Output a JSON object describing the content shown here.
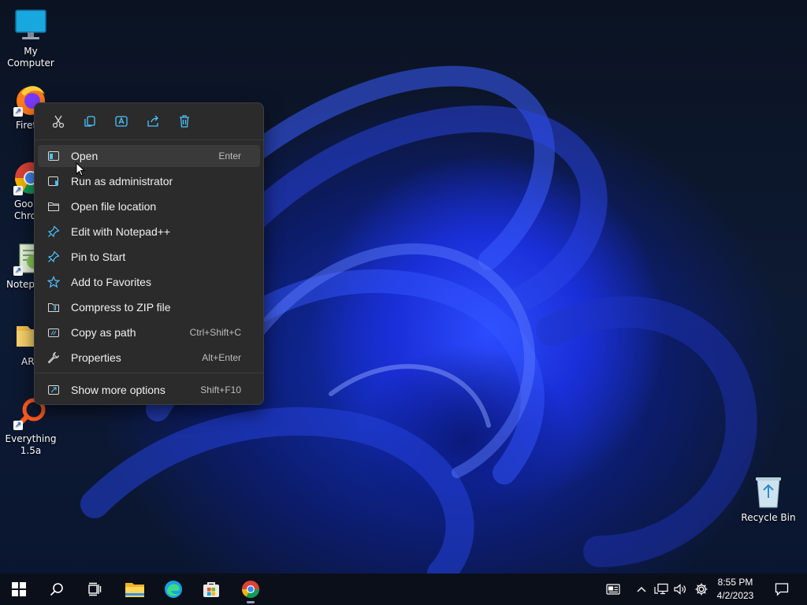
{
  "desktop": {
    "icons": [
      {
        "label": "My Computer"
      },
      {
        "label": "Firef"
      },
      {
        "label": "Goo Chro"
      },
      {
        "label": "Notep"
      },
      {
        "label": "AR"
      },
      {
        "label": "Everything 1.5a"
      },
      {
        "label": "Recycle Bin"
      }
    ]
  },
  "context_menu": {
    "toolbar": [
      "cut-icon",
      "copy-icon",
      "rename-icon",
      "share-icon",
      "delete-icon"
    ],
    "items": [
      {
        "label": "Open",
        "shortcut": "Enter",
        "icon": "open-window-icon"
      },
      {
        "label": "Run as administrator",
        "shortcut": "",
        "icon": "admin-shield-icon"
      },
      {
        "label": "Open file location",
        "shortcut": "",
        "icon": "folder-icon"
      },
      {
        "label": "Edit with Notepad++",
        "shortcut": "",
        "icon": "pin-icon"
      },
      {
        "label": "Pin to Start",
        "shortcut": "",
        "icon": "pin-icon"
      },
      {
        "label": "Add to Favorites",
        "shortcut": "",
        "icon": "star-icon"
      },
      {
        "label": "Compress to ZIP file",
        "shortcut": "",
        "icon": "zip-icon"
      },
      {
        "label": "Copy as path",
        "shortcut": "Ctrl+Shift+C",
        "icon": "copy-path-icon"
      },
      {
        "label": "Properties",
        "shortcut": "Alt+Enter",
        "icon": "wrench-icon"
      },
      {
        "label": "Show more options",
        "shortcut": "Shift+F10",
        "icon": "more-options-icon"
      }
    ]
  },
  "taskbar": {
    "time": "8:55 PM",
    "date": "4/2/2023",
    "accent": "#4cc2ff"
  }
}
